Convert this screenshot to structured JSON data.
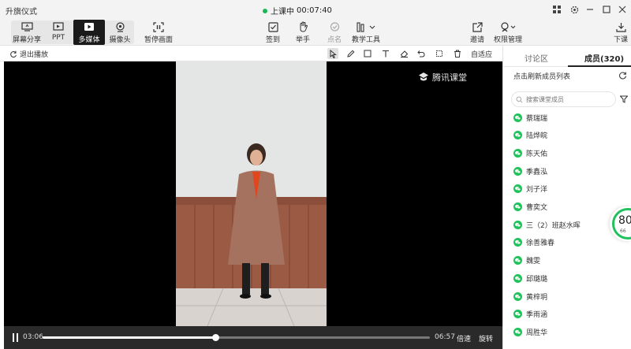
{
  "window": {
    "title": "升旗仪式"
  },
  "status": {
    "live_label": "上课中",
    "timer": "00:07:40",
    "colors": {
      "live": "#19b955"
    }
  },
  "toolbar": {
    "left": [
      {
        "label": "屏幕分享",
        "icon": "screen-share-icon"
      },
      {
        "label": "PPT",
        "icon": "ppt-icon"
      },
      {
        "label": "多媒体",
        "icon": "play-icon",
        "active": true
      },
      {
        "label": "摄像头",
        "icon": "camera-icon"
      },
      {
        "label": "暂停画面",
        "icon": "pause-frame-icon"
      }
    ],
    "center": [
      {
        "label": "签到",
        "icon": "check-in-icon"
      },
      {
        "label": "举手",
        "icon": "raise-hand-icon"
      },
      {
        "label": "点名",
        "icon": "roll-call-icon"
      },
      {
        "label": "教学工具",
        "icon": "teaching-tools-icon"
      }
    ],
    "right": [
      {
        "label": "邀请",
        "icon": "invite-icon"
      },
      {
        "label": "权限管理",
        "icon": "permission-icon"
      },
      {
        "label": "下课",
        "icon": "end-class-icon"
      }
    ]
  },
  "subbar": {
    "exit_label": "退出播放",
    "fit_label": "自适应"
  },
  "video": {
    "watermark": "腾讯课堂"
  },
  "player": {
    "current_time": "03:06",
    "total_time": "06:57",
    "progress": 0.446,
    "speed_label": "倍速",
    "rotate_label": "旋转"
  },
  "panel": {
    "tabs": [
      {
        "label": "讨论区"
      },
      {
        "label": "成员(320)",
        "active": true
      }
    ],
    "refresh_label": "点击刷新成员列表",
    "search_placeholder": "搜索课堂成员",
    "members": [
      "蔡瑞瑞",
      "陆烨皖",
      "陈天佑",
      "季鑫泓",
      "刘子洋",
      "曹奕文",
      "三（2）班赵水晖",
      "徐善雅春",
      "魏雯",
      "邱璐璐",
      "黄梓玥",
      "季雨涵",
      "周胜华"
    ],
    "colors": {
      "member_icon": "#1ec35a"
    }
  },
  "network": {
    "score": "80",
    "sub": "66"
  }
}
